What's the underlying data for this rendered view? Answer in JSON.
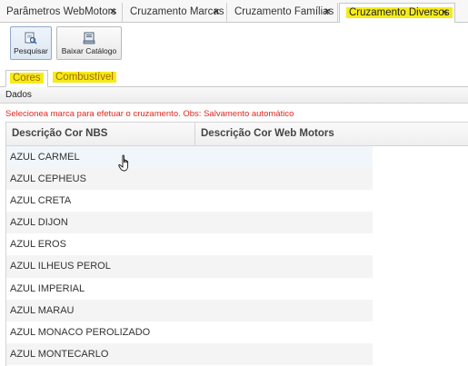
{
  "tabs": [
    {
      "label": "Parâmetros WebMotors",
      "close": "×"
    },
    {
      "label": "Cruzamento Marcas",
      "close": "×"
    },
    {
      "label": "Cruzamento Famílias",
      "close": "×"
    },
    {
      "label": "Cruzamento Diversos",
      "close": "×"
    }
  ],
  "toolbar": {
    "pesquisar_label": "Pesquisar",
    "baixar_label": "Baixar Catálogo"
  },
  "subtabs": [
    "Cores",
    "Combustível"
  ],
  "panel": {
    "title": "Dados",
    "info": "Selecionea marca para efetuar o cruzamento. Obs: Salvamento automático"
  },
  "grid": {
    "columns": [
      "Descrição Cor NBS",
      "Descrição Cor Web Motors"
    ],
    "rows": [
      "AZUL CARMEL",
      "AZUL CEPHEUS",
      "AZUL CRETA",
      "AZUL DIJON",
      "AZUL EROS",
      "AZUL ILHEUS PEROL",
      "AZUL IMPERIAL",
      "AZUL MARAU",
      "AZUL MONACO PEROLIZADO",
      "AZUL MONTECARLO"
    ]
  },
  "colors": {
    "highlight": "#f5eb1a",
    "info_text": "#e0261d"
  }
}
